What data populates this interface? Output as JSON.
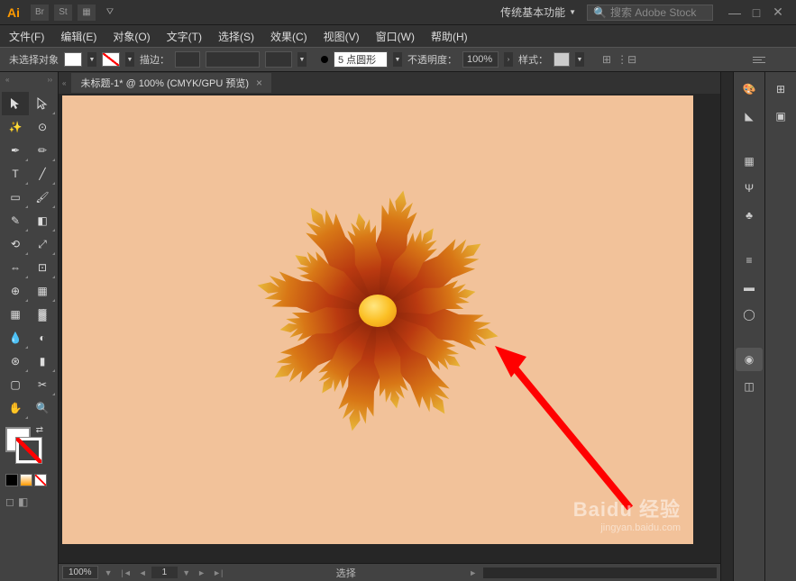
{
  "app": {
    "logo": "Ai",
    "workspace": "传统基本功能",
    "search_placeholder": "搜索 Adobe Stock"
  },
  "menu": {
    "file": "文件(F)",
    "edit": "编辑(E)",
    "object": "对象(O)",
    "type": "文字(T)",
    "select": "选择(S)",
    "effect": "效果(C)",
    "view": "视图(V)",
    "window": "窗口(W)",
    "help": "帮助(H)"
  },
  "control": {
    "selection_status": "未选择对象",
    "stroke_label": "描边：",
    "profile_value": "5 点圆形",
    "opacity_label": "不透明度：",
    "opacity_value": "100%",
    "style_label": "样式："
  },
  "document": {
    "tab_title": "未标题-1* @ 100% (CMYK/GPU 预览)",
    "zoom": "100%",
    "page": "1",
    "status_mode": "选择"
  },
  "watermark": {
    "main": "Baidu 经验",
    "sub": "jingyan.baidu.com"
  }
}
